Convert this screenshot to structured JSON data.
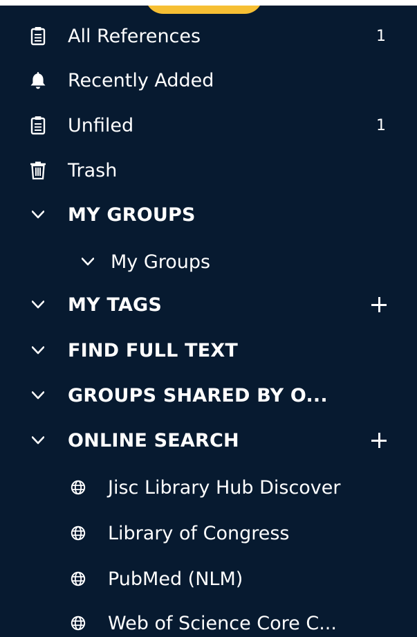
{
  "sidebar": {
    "library_items": [
      {
        "label": "All References",
        "count": "1",
        "icon": "clipboard-icon"
      },
      {
        "label": "Recently Added",
        "icon": "bell-icon"
      },
      {
        "label": "Unfiled",
        "count": "1",
        "icon": "clipboard-icon"
      },
      {
        "label": "Trash",
        "icon": "trash-icon"
      }
    ],
    "sections": {
      "my_groups": {
        "label": "MY GROUPS",
        "child": "My Groups"
      },
      "my_tags": {
        "label": "MY TAGS"
      },
      "find_full_text": {
        "label": "FIND FULL TEXT"
      },
      "groups_shared": {
        "label": "GROUPS SHARED BY O..."
      },
      "online_search": {
        "label": "ONLINE SEARCH",
        "items": [
          {
            "label": "Jisc Library Hub Discover",
            "icon": "globe-icon"
          },
          {
            "label": "Library of Congress",
            "icon": "globe-icon"
          },
          {
            "label": "PubMed (NLM)",
            "icon": "globe-icon"
          },
          {
            "label": "Web of Science Core C...",
            "icon": "globe-icon"
          }
        ]
      }
    },
    "colors": {
      "background": "#071a30",
      "text": "#ffffff",
      "accent": "#f6bf34"
    }
  }
}
